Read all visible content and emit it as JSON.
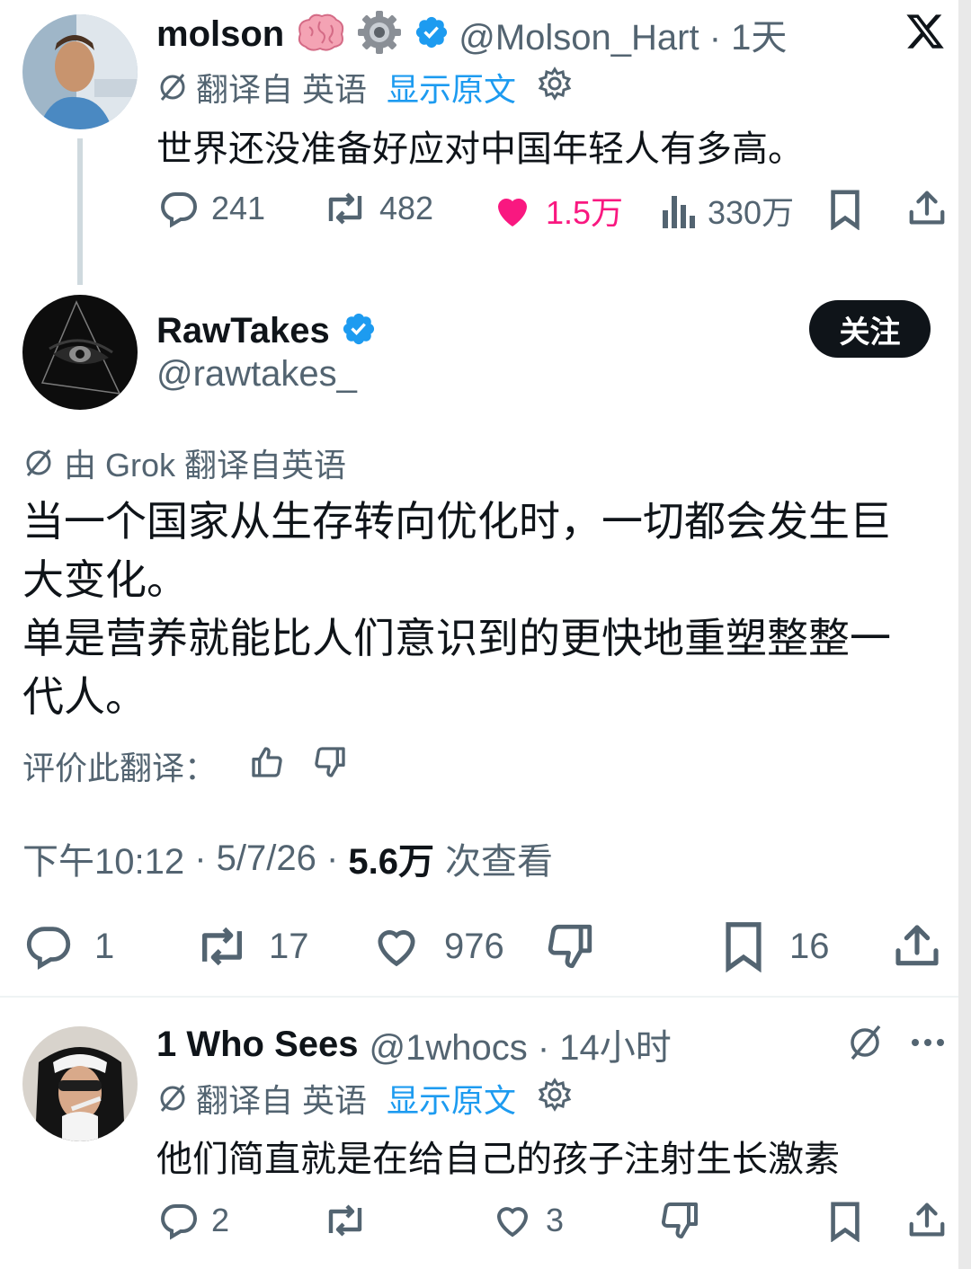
{
  "colors": {
    "text": "#0f1419",
    "secondary": "#536471",
    "link": "#1d9bf0",
    "like": "#f91880",
    "verified": "#1d9bf0",
    "follow_button_bg": "#0f1419"
  },
  "quoted_post": {
    "author_name": "molson",
    "emojis": [
      "brain-emoji",
      "gear-emoji"
    ],
    "handle_time": "@Molson_Hart · 1天",
    "translation_label": "翻译自 英语",
    "show_original": "显示原文",
    "text": "世界还没准备好应对中国年轻人有多高。",
    "actions": {
      "replies": "241",
      "reposts": "482",
      "likes": "1.5万",
      "views": "330万"
    }
  },
  "main_post": {
    "author_name": "RawTakes",
    "handle": "@rawtakes_",
    "follow_label": "关注",
    "grok_translation_label": "由 Grok 翻译自英语",
    "text_lines": [
      "当一个国家从生存转向优化时，一切都会发生巨",
      "大变化。",
      "单是营养就能比人们意识到的更快地重塑整整一",
      "代人。"
    ],
    "rate_translation_label": "评价此翻译：",
    "time": "下午10:12",
    "date": "5/7/26",
    "views_count": "5.6万",
    "views_label": "次查看",
    "actions": {
      "replies": "1",
      "reposts": "17",
      "likes": "976",
      "bookmarks": "16"
    }
  },
  "reply_post": {
    "author_name": "1 Who Sees",
    "handle_time": "@1whocs · 14小时",
    "translation_label": "翻译自 英语",
    "show_original": "显示原文",
    "text": "他们简直就是在给自己的孩子注射生长激素",
    "actions": {
      "replies": "2",
      "likes": "3"
    }
  }
}
